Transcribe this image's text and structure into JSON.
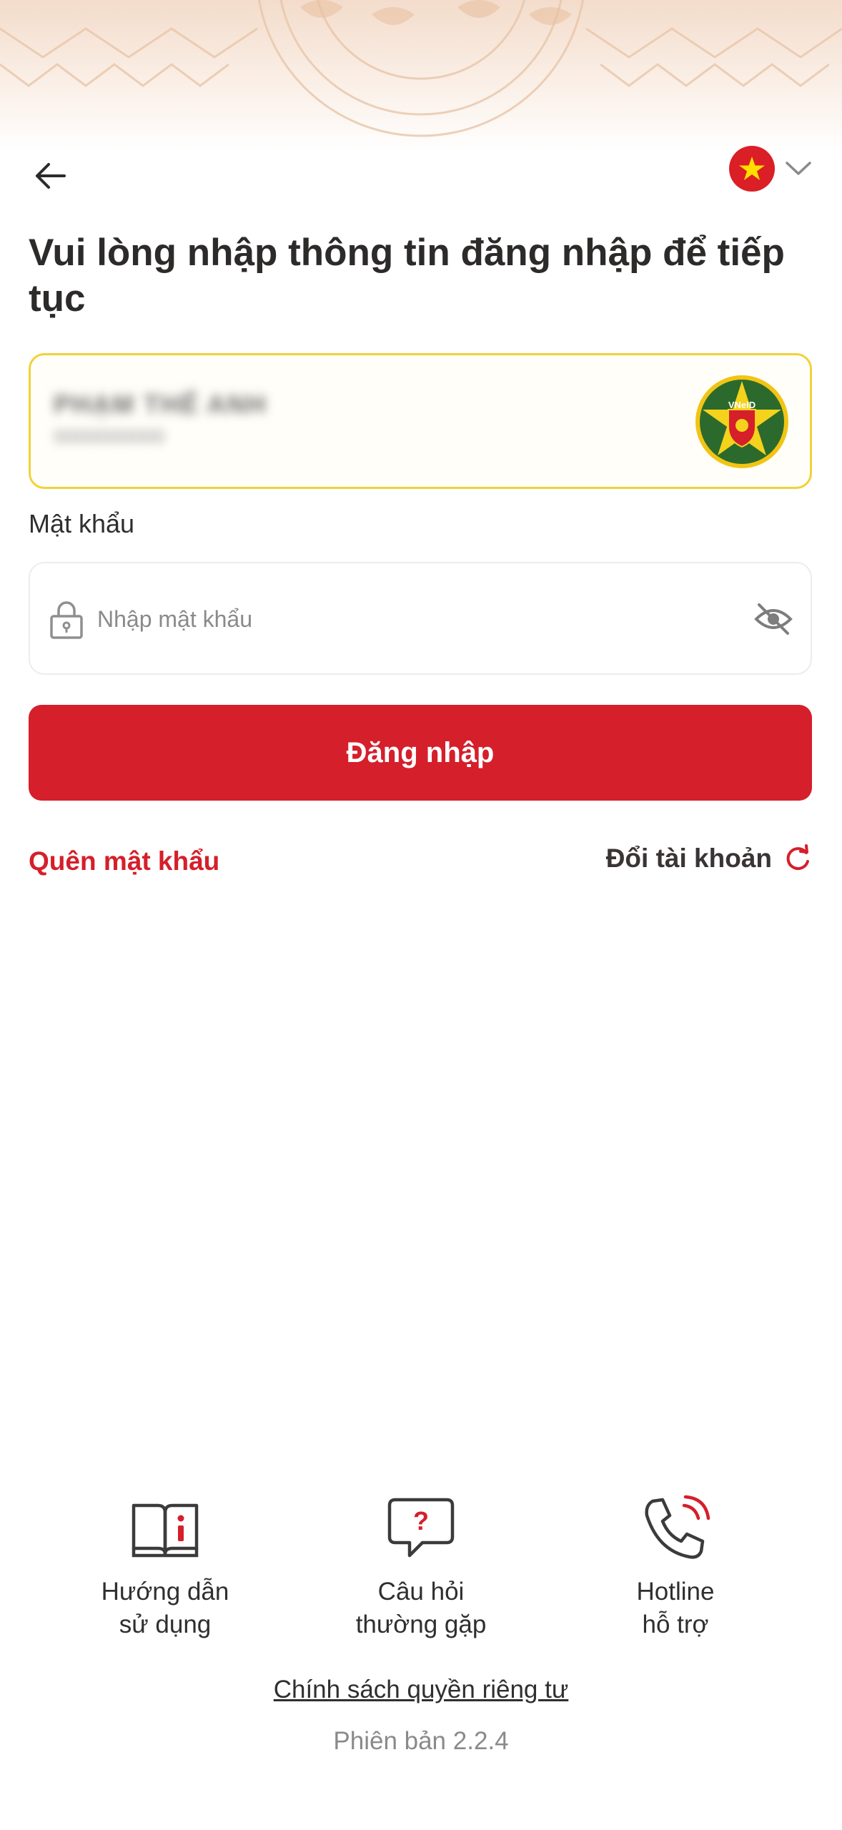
{
  "header": {
    "language_flag": "vietnam-flag-icon"
  },
  "title": "Vui lòng nhập thông tin đăng nhập để tiếp tục",
  "account": {
    "name": "PHẠM THẾ ANH",
    "sub": "0000000000",
    "logo_text": "VNeID"
  },
  "password": {
    "label": "Mật khẩu",
    "placeholder": "Nhập mật khẩu",
    "value": ""
  },
  "login_button": "Đăng nhập",
  "links": {
    "forgot_password": "Quên mật khẩu",
    "switch_account": "Đổi tài khoản"
  },
  "help": [
    {
      "label": "Hướng dẫn\nsử dụng",
      "icon": "book-info-icon"
    },
    {
      "label": "Câu hỏi\nthường gặp",
      "icon": "question-chat-icon"
    },
    {
      "label": "Hotline\nhỗ trợ",
      "icon": "phone-icon"
    }
  ],
  "privacy_link": "Chính sách quyền riêng tư",
  "version": "Phiên bản 2.2.4",
  "colors": {
    "primary_red": "#d51f2b",
    "account_border": "#f0d23a",
    "flag_red": "#da1f26",
    "flag_star": "#ffde00"
  }
}
